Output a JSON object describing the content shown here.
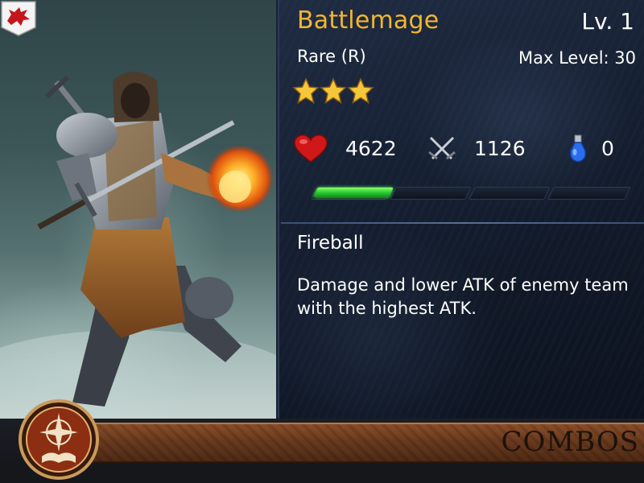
{
  "card": {
    "name": "Battlemage",
    "level_label": "Lv. 1",
    "rarity": "Rare (R)",
    "max_level_label": "Max Level: 30",
    "stars": 3
  },
  "stats": {
    "hp": "4622",
    "atk": "1126",
    "mana": "0"
  },
  "experience": {
    "progress_fraction": 0.24
  },
  "skill": {
    "name": "Fireball",
    "description": "Damage and lower ATK of enemy team with the highest ATK."
  },
  "footer": {
    "combos_label": "COMBOS"
  },
  "icons": {
    "faction": "red-dragon-icon",
    "hp": "heart-icon",
    "atk": "crossed-swords-icon",
    "mana": "potion-icon",
    "combo": "compass-book-icon"
  },
  "colors": {
    "name": "#f2b630",
    "xp_fill": "#2fd33a",
    "hp": "#d01818",
    "mana": "#2a6cf0"
  }
}
